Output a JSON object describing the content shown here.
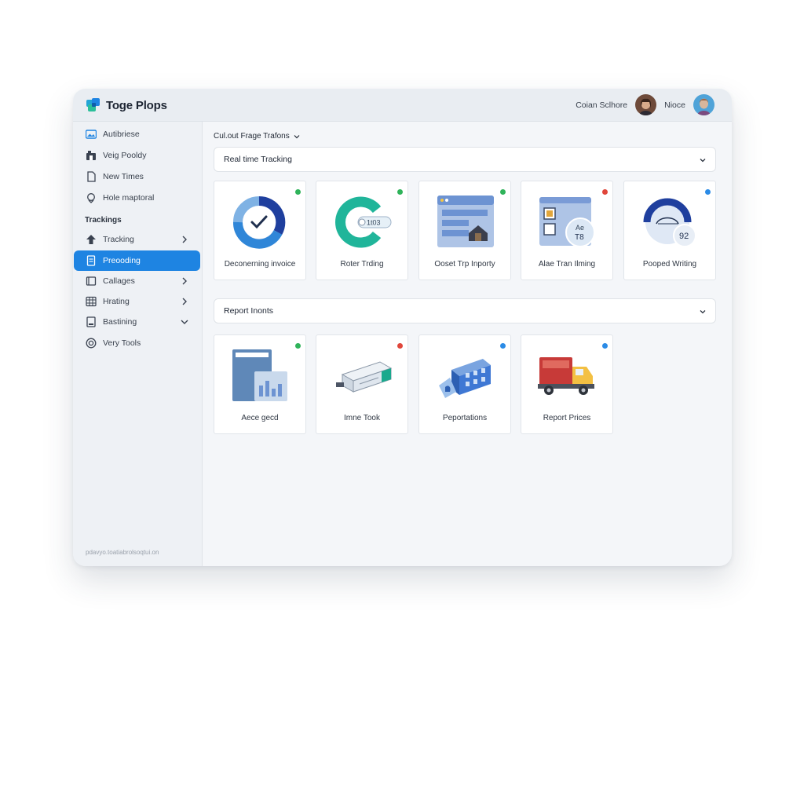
{
  "app": {
    "title": "Toge Plops",
    "top_link": "Coian Sclhore",
    "user_name": "Nioce"
  },
  "sidebar": {
    "items_top": [
      {
        "label": "Autibriese",
        "icon": "image-icon"
      },
      {
        "label": "Veig Pooldy",
        "icon": "shop-icon"
      },
      {
        "label": "New Times",
        "icon": "document-icon"
      },
      {
        "label": "Hole maptoral",
        "icon": "location-pin-icon"
      }
    ],
    "section_label": "Trackings",
    "items_section": [
      {
        "label": "Tracking",
        "icon": "upload-icon",
        "has_chevron": "right"
      },
      {
        "label": "Preooding",
        "icon": "document-icon",
        "active": true
      },
      {
        "label": "Callages",
        "icon": "book-icon",
        "has_chevron": "right"
      },
      {
        "label": "Hrating",
        "icon": "grid-icon",
        "has_chevron": "right"
      },
      {
        "label": "Bastining",
        "icon": "file-icon",
        "has_chevron": "down"
      },
      {
        "label": "Very Tools",
        "icon": "target-icon"
      }
    ],
    "footnote": "pdavyo.toatiabrolsoqtui.on"
  },
  "main": {
    "breadcrumb": "Cul.out Frage Trafons",
    "section1": {
      "title": "Real time Tracking",
      "cards": [
        {
          "label": "Deconerning invoice",
          "icon": "donut-check-icon",
          "status": "green"
        },
        {
          "label": "Roter Trding",
          "icon": "ring-chart-icon",
          "status": "green",
          "badge": "1t03"
        },
        {
          "label": "Ooset Trp Inporty",
          "icon": "browser-window-icon",
          "status": "green"
        },
        {
          "label": "Alae Tran Ilming",
          "icon": "screen-badge-icon",
          "status": "red",
          "badge_top": "Ae",
          "badge_bottom": "T8"
        },
        {
          "label": "Pooped Writing",
          "icon": "gauge-icon",
          "status": "blue",
          "badge": "92"
        }
      ]
    },
    "section2": {
      "title": "Report Inonts",
      "cards": [
        {
          "label": "Aece gecd",
          "icon": "report-doc-icon",
          "status": "green"
        },
        {
          "label": "Imne Took",
          "icon": "container-icon",
          "status": "red"
        },
        {
          "label": "Peportations",
          "icon": "building-icon",
          "status": "blue"
        },
        {
          "label": "Report Prices",
          "icon": "truck-icon",
          "status": "blue"
        }
      ]
    }
  },
  "colors": {
    "accent": "#1e84e2",
    "status_green": "#2fb35a",
    "status_red": "#e0463b",
    "status_blue": "#2b8be6"
  }
}
